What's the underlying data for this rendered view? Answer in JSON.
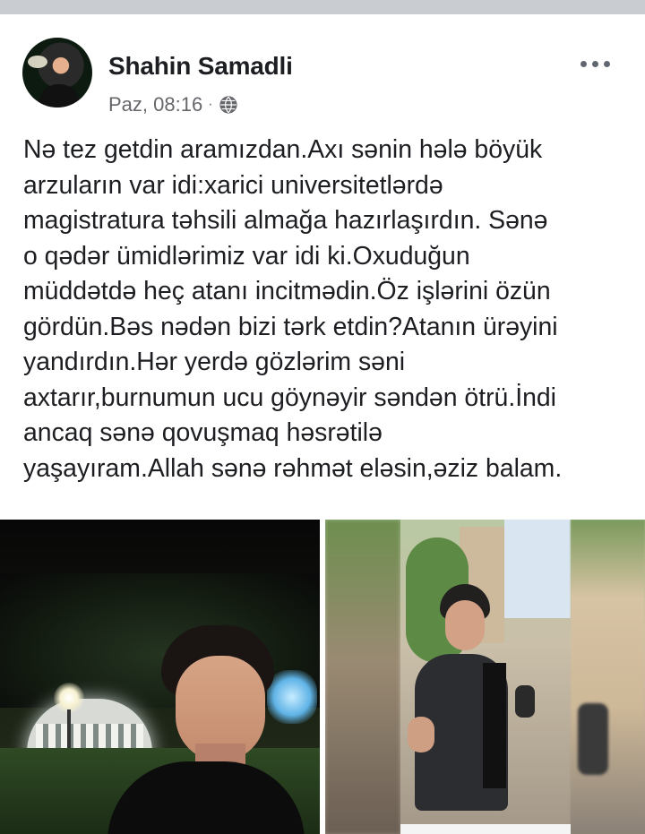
{
  "post": {
    "author": "Shahin Samadli",
    "timestamp": "Paz, 08:16",
    "separator": "·",
    "privacy_icon": "globe-icon",
    "menu_icon": "more-options-icon",
    "text_lines": [
      "Nə tez getdin aramızdan.Axı sənin hələ böyük",
      "arzuların var idi:xarici universitetlərdə",
      "magistratura təhsili almağa hazırlaşırdın. Sənə",
      "o qədər ümidlərimiz var idi ki.Oxuduğun",
      "müddətdə heç atanı incitmədin.Öz işlərini özün",
      "gördün.Bəs nədən bizi tərk etdin?Atanın ürəyini",
      "yandırdın.Hər yerdə gözlərim səni",
      "axtarır,burnumun ucu göynəyir səndən ötrü.İndi",
      "ancaq sənə qovuşmaq həsrətilə",
      "yaşayıram.Allah sənə rəhmət eləsin,əziz balam."
    ]
  },
  "photos": [
    {
      "name": "photo-night-portrait"
    },
    {
      "name": "photo-street-screenshot"
    }
  ],
  "colors": {
    "text": "#1c1e21",
    "secondary": "#65676b",
    "strip": "#c9ccd1"
  }
}
